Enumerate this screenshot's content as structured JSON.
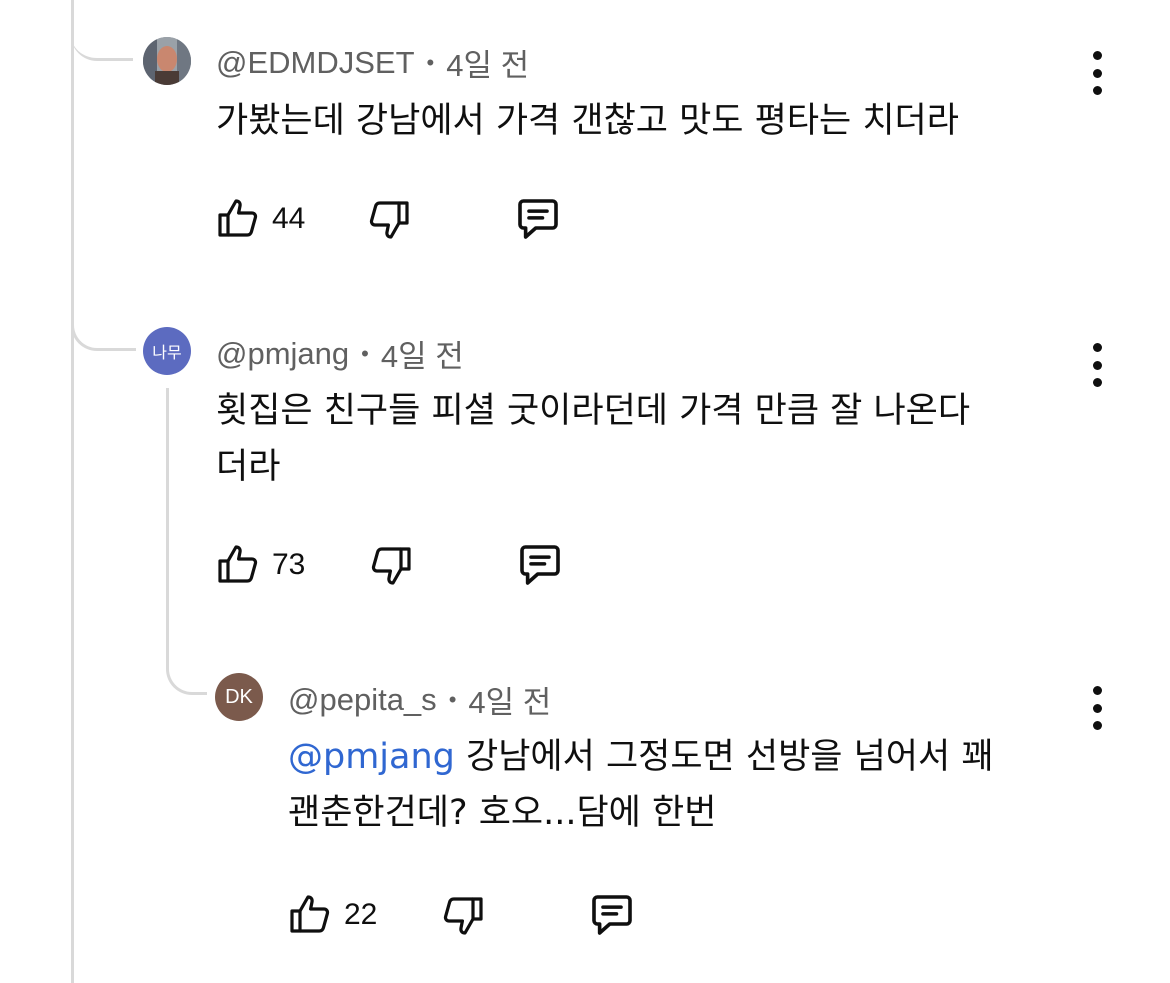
{
  "comments": [
    {
      "handle": "@EDMDJSET",
      "time": "4일 전",
      "text_line1": "가봤는데 강남에서 가격 갠찮고 맛도 평타는 치더라",
      "text_line2": "",
      "likes": "44",
      "avatar_icon": "photo-avatar"
    },
    {
      "handle": "@pmjang",
      "time": "4일 전",
      "avatar_text": "나무",
      "avatar_color": "#5c6bc0",
      "text_line1": "횟집은 친구들 피셜 굿이라던데 가격 만큼 잘 나온다",
      "text_line2": "더라",
      "likes": "73"
    },
    {
      "handle": "@pepita_s",
      "time": "4일 전",
      "avatar_text": "DK",
      "avatar_color": "#7b5a4c",
      "mention": "@pmjang",
      "text_line1": " 강남에서 그정도면 선방을 넘어서 꽤",
      "text_line2": "괜춘한건데? 호오...담에 한번",
      "likes": "22"
    }
  ],
  "colors": {
    "text": "#0f0f0f",
    "meta": "#606060",
    "mention": "#3067d1",
    "thread_line": "#d9d9d9"
  },
  "icons": [
    "like-icon",
    "dislike-icon",
    "reply-icon",
    "more-vertical-icon"
  ]
}
